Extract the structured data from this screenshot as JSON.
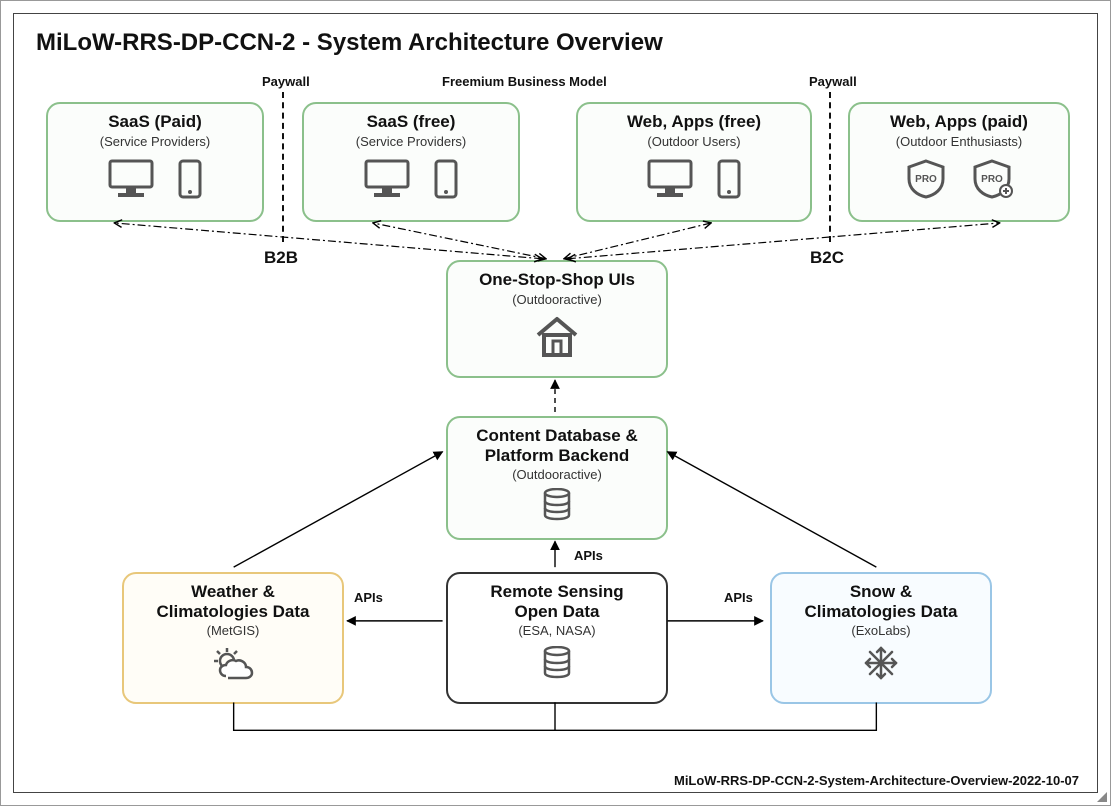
{
  "title": "MiLoW-RRS-DP-CCN-2 - System Architecture Overview",
  "paywall_left": "Paywall",
  "paywall_right": "Paywall",
  "freemium": "Freemium Business Model",
  "b2b": "B2B",
  "b2c": "B2C",
  "api_top": "APIs",
  "api_left": "APIs",
  "api_right": "APIs",
  "footer": "MiLoW-RRS-DP-CCN-2-System-Architecture-Overview-2022-10-07",
  "boxes": {
    "saas_paid": {
      "title": "SaaS (Paid)",
      "sub": "(Service Providers)"
    },
    "saas_free": {
      "title": "SaaS (free)",
      "sub": "(Service Providers)"
    },
    "web_free": {
      "title": "Web, Apps (free)",
      "sub": "(Outdoor Users)"
    },
    "web_paid": {
      "title": "Web, Apps (paid)",
      "sub": "(Outdoor Enthusiasts)"
    },
    "oss": {
      "title": "One-Stop-Shop UIs",
      "sub": "(Outdooractive)"
    },
    "backend": {
      "title": "Content Database &\nPlatform Backend",
      "sub": "(Outdooractive)"
    },
    "weather": {
      "title": "Weather &\nClimatologies Data",
      "sub": "(MetGIS)"
    },
    "remote": {
      "title": "Remote Sensing\nOpen Data",
      "sub": "(ESA, NASA)"
    },
    "snow": {
      "title": "Snow &\nClimatologies Data",
      "sub": "(ExoLabs)"
    }
  }
}
